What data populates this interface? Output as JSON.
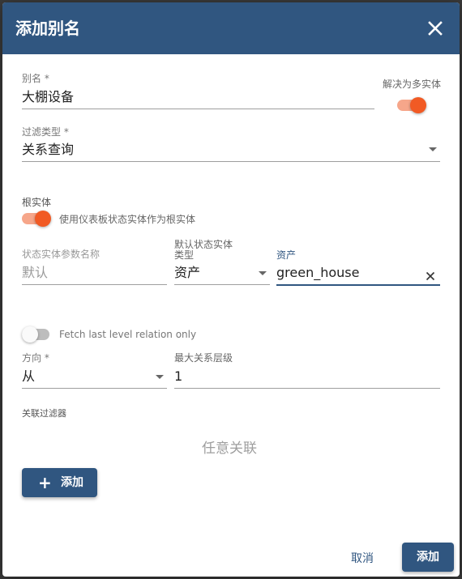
{
  "dialog": {
    "title": "添加别名",
    "close_icon": "close-icon"
  },
  "alias": {
    "label": "别名 *",
    "value": "大棚设备"
  },
  "resolve_multiple": {
    "label": "解决为多实体",
    "checked": true
  },
  "filter_type": {
    "label": "过滤类型 *",
    "value": "关系查询"
  },
  "root_entity": {
    "label": "根实体",
    "toggle_label": "使用仪表板状态实体作为根实体",
    "checked": true
  },
  "state_param": {
    "label": "状态实体参数名称",
    "placeholder": "默认"
  },
  "default_type": {
    "label_line1": "默认状态实体",
    "label_line2": "类型",
    "value": "资产"
  },
  "asset": {
    "label": "资产",
    "value": "green_house"
  },
  "fetch_last": {
    "label": "Fetch last level relation only",
    "checked": false
  },
  "direction": {
    "label": "方向 *",
    "value": "从"
  },
  "max_level": {
    "label": "最大关系层级",
    "value": "1"
  },
  "relation_filters": {
    "label": "关联过滤器",
    "empty_text": "任意关联",
    "add_label": "添加"
  },
  "actions": {
    "cancel_label": "取消",
    "submit_label": "添加"
  },
  "colors": {
    "primary": "#305680",
    "accent": "#f15a24"
  }
}
